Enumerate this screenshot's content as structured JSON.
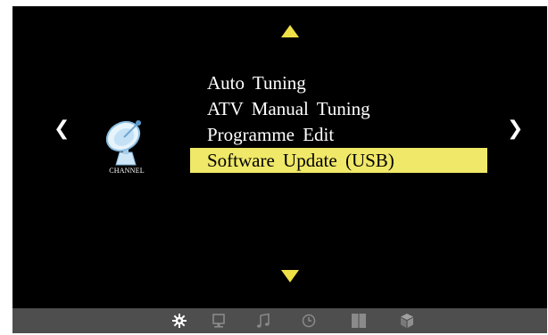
{
  "page": {
    "category_label": "CHANNEL",
    "nav_left_glyph": "❮",
    "nav_right_glyph": "❯"
  },
  "menu": {
    "items": [
      {
        "label": "Auto Tuning",
        "selected": false
      },
      {
        "label": "ATV Manual Tuning",
        "selected": false
      },
      {
        "label": "Programme Edit",
        "selected": false
      },
      {
        "label": "Software Update (USB)",
        "selected": true
      }
    ]
  },
  "icons": {
    "category": "satellite-dish-icon",
    "scroll_up": "arrow-up-icon",
    "scroll_down": "arrow-down-icon"
  },
  "bottom_tabs": [
    {
      "icon": "channel-gear-icon",
      "active": true
    },
    {
      "icon": "picture-monitor-icon",
      "active": false
    },
    {
      "icon": "sound-note-icon",
      "active": false
    },
    {
      "icon": "time-clock-icon",
      "active": false
    },
    {
      "icon": "lock-panels-icon",
      "active": false
    },
    {
      "icon": "setup-cube-icon",
      "active": false
    }
  ],
  "colors": {
    "highlight": "#f0e868",
    "arrow": "#f0e048",
    "background": "#000000",
    "bottom_bar": "#4e4e4e",
    "tab_inactive": "#8a8a8a",
    "tab_active": "#ffffff"
  }
}
